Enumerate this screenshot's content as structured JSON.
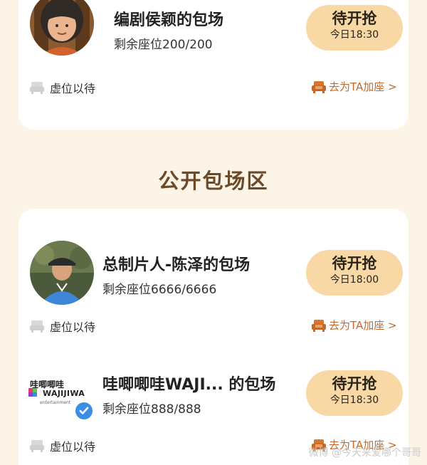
{
  "section_header": "公开包场区",
  "top_card": {
    "title": "编剧侯颖的包场",
    "seats": "剩余座位200/200",
    "button_main": "待开抢",
    "button_time": "今日18:30",
    "wait_label": "虚位以待",
    "join_label": "去为TA加座 >"
  },
  "public_rooms": [
    {
      "title": "总制片人-陈泽的包场",
      "seats": "剩余座位6666/6666",
      "button_main": "待开抢",
      "button_time": "今日18:00",
      "wait_label": "虚位以待",
      "join_label": "去为TA加座 >"
    },
    {
      "title": "哇唧唧哇WAJI... 的包场",
      "seats": "剩余座位888/888",
      "button_main": "待开抢",
      "button_time": "今日18:30",
      "wait_label": "虚位以待",
      "join_label": "去为TA加座 >",
      "logo_cn": "哇唧唧哇",
      "logo_en": "WAJIJIWA",
      "logo_sub": "entertainment"
    }
  ],
  "watermark": "微博 @今天来爱哪个哥哥",
  "colors": {
    "background": "#fcf4e6",
    "button": "#f8d8a5",
    "accent": "#c26a2b",
    "section_title": "#6a4a28"
  },
  "icons": [
    "empty-seat-icon",
    "sofa-icon",
    "verified-icon"
  ]
}
